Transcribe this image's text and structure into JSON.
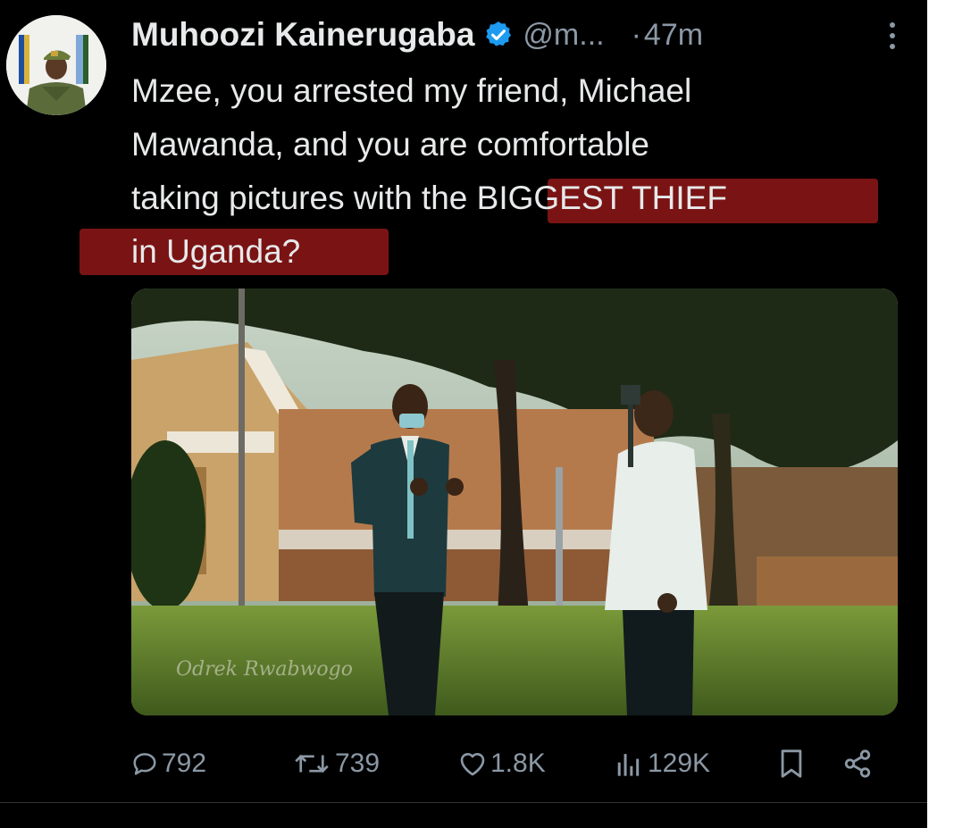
{
  "tweet": {
    "author_name": "Muhoozi Kainerugaba",
    "handle": "@m...",
    "separator": "·",
    "time": "47m",
    "text_lines": [
      "Mzee, you arrested my friend, Michael",
      "Mawanda, and you are comfortable",
      "taking pictures with th",
      "e BIGGEST THIEF",
      "in Uganda?"
    ],
    "highlight_color": "#9c1a1a",
    "media": {
      "watermark": "Odrek Rwabwogo"
    }
  },
  "actions": {
    "replies": "792",
    "reposts": "739",
    "likes": "1.8K",
    "views": "129K"
  },
  "colors": {
    "background": "#000000",
    "text_primary": "#e7e9ea",
    "text_secondary": "#8b98a5",
    "verified_blue": "#1d9bf0"
  },
  "icons": [
    "verified-badge-icon",
    "more-icon",
    "reply-icon",
    "repost-icon",
    "like-icon",
    "views-icon",
    "bookmark-icon",
    "share-icon"
  ]
}
